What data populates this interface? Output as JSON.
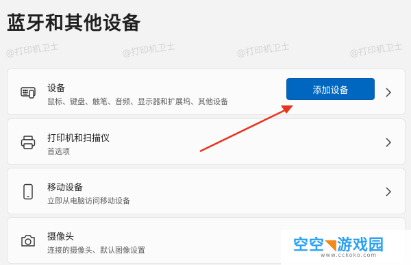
{
  "page": {
    "title": "蓝牙和其他设备"
  },
  "watermark": {
    "text": "@打印机卫士"
  },
  "cards": [
    {
      "title": "设备",
      "subtitle": "鼠标、键盘、触笔、音频、显示器和扩展坞、其他设备",
      "icon": "keyboard-device-icon"
    },
    {
      "title": "打印机和扫描仪",
      "subtitle": "首选项",
      "icon": "printer-icon"
    },
    {
      "title": "移动设备",
      "subtitle": "立即从电脑访问移动设备",
      "icon": "phone-icon"
    },
    {
      "title": "摄像头",
      "subtitle": "连接的摄像头、默认图像设置",
      "icon": "camera-icon"
    }
  ],
  "devices": {
    "add_button_label": "添加设备"
  },
  "logo": {
    "text_main": "空空",
    "text_tail": "游戏园",
    "sub": "www.cckoko.com"
  },
  "colors": {
    "accent": "#0067c0",
    "annotation": "#e8321c",
    "background": "#f3f3f3",
    "card": "#fbfbfb"
  }
}
